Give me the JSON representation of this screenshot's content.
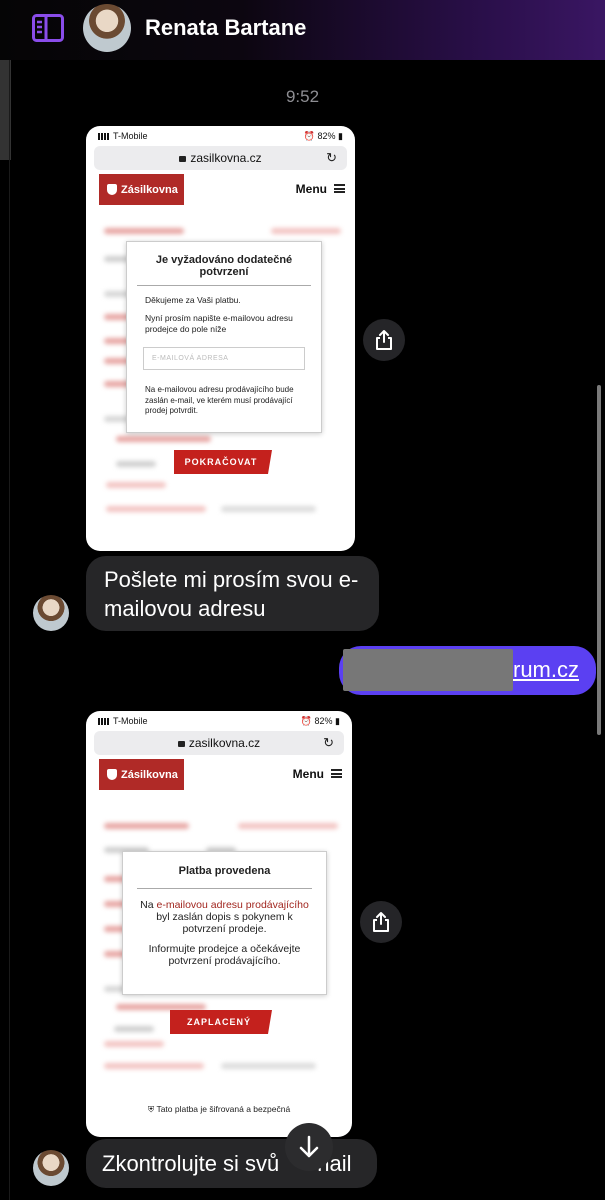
{
  "header": {
    "contact_name": "Renata Bartane",
    "sidebar_icon": "sidebar-toggle-icon",
    "accent": "#7b3fe4"
  },
  "thread": {
    "timestamp": "9:52"
  },
  "screenshot1": {
    "carrier": "T-Mobile",
    "battery": "82%",
    "url": "zasilkovna.cz",
    "logo": "Zásilkovna",
    "menu": "Menu",
    "modal_title": "Je vyžadováno dodatečné potvrzení",
    "thanks": "Děkujeme za Vaši platbu.",
    "instruction": "Nyní prosím napište e-mailovou adresu prodejce do pole níže",
    "placeholder": "E-MAILOVÁ ADRESA",
    "note": "Na e-mailovou adresu prodávajícího bude zaslán e-mail, ve kterém musí prodávající prodej potvrdit.",
    "button": "POKRAČOVAT"
  },
  "message1": "Pošlete mi prosím svou e-mailovou adresu",
  "outgoing": {
    "visible_text": "rum.cz",
    "color": "#5b40f2"
  },
  "screenshot2": {
    "carrier": "T-Mobile",
    "battery": "82%",
    "url": "zasilkovna.cz",
    "logo": "Zásilkovna",
    "menu": "Menu",
    "modal_title": "Platba provedena",
    "text_before": "Na",
    "link_text": "e-mailovou adresu prodávajícího",
    "text_after": "byl zaslán dopis s pokynem k potvrzení prodeje.",
    "text2": "Informujte prodejce a očekávejte potvrzení prodávajícího.",
    "button": "ZAPLACENÝ",
    "secure_note": "Tato platba je šifrovaná a bezpečná"
  },
  "message2": {
    "before": "Zkontrolujte si svů",
    "after": "nail"
  },
  "icons": {
    "share": "share-icon",
    "scroll_down": "arrow-down-icon"
  }
}
